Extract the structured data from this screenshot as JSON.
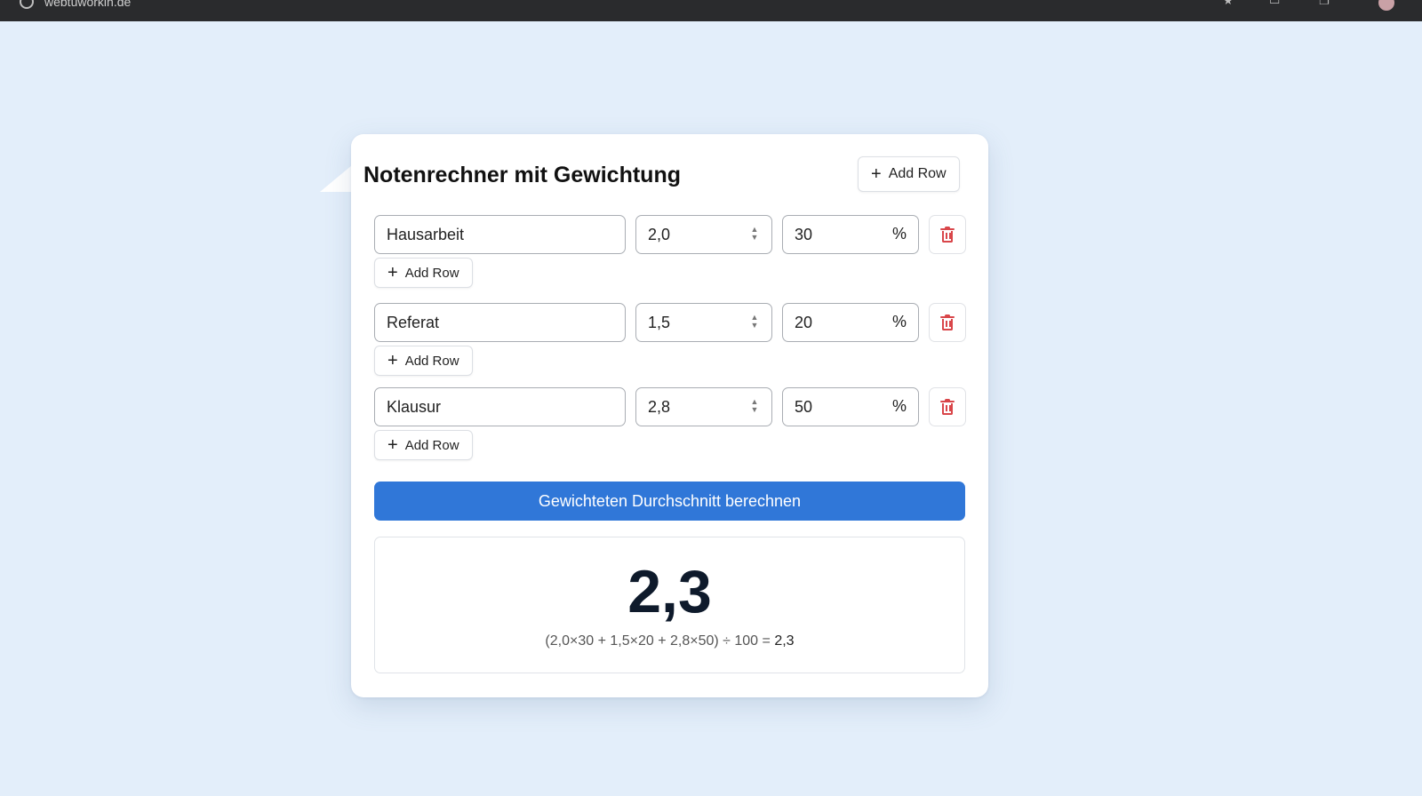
{
  "browser": {
    "url": "webtuworkin.de"
  },
  "app": {
    "title": "Notenrechner mit Gewichtung",
    "add_row_label": "Add Row",
    "percent_symbol": "%",
    "calculate_label": "Gewichteten Durchschnitt berechnen"
  },
  "rows": [
    {
      "name": "Hausarbeit",
      "grade": "2,0",
      "weight": "30"
    },
    {
      "name": "Referat",
      "grade": "1,5",
      "weight": "20"
    },
    {
      "name": "Klausur",
      "grade": "2,8",
      "weight": "50"
    }
  ],
  "result": {
    "value": "2,3",
    "formula": "(2,0×30 + 1,5×20 + 2,8×50) ÷ 100 =",
    "formula_result": "2,3"
  },
  "colors": {
    "accent": "#3077d8",
    "delete": "#d9464a",
    "background": "#e3eefa"
  },
  "icons": [
    "plus-icon",
    "trash-icon",
    "spinner-icon"
  ]
}
